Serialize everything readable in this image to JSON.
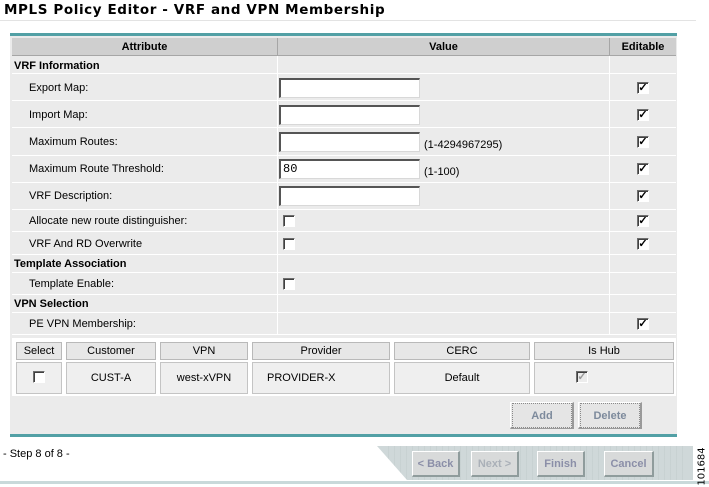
{
  "title": "MPLS Policy Editor - VRF and VPN Membership",
  "columns": {
    "attribute": "Attribute",
    "value": "Value",
    "editable": "Editable"
  },
  "sections": {
    "vrf_info": "VRF Information",
    "template_assoc": "Template Association",
    "vpn_selection": "VPN Selection"
  },
  "fields": {
    "export_map": {
      "label": "Export Map:",
      "value": "",
      "editable": true
    },
    "import_map": {
      "label": "Import Map:",
      "value": "",
      "editable": true
    },
    "max_routes": {
      "label": "Maximum Routes:",
      "value": "",
      "hint": "(1-4294967295)",
      "editable": true
    },
    "max_route_threshold": {
      "label": "Maximum Route Threshold:",
      "value": "80",
      "hint": "(1-100)",
      "editable": true
    },
    "vrf_description": {
      "label": "VRF Description:",
      "value": "",
      "editable": true
    },
    "allocate_rd": {
      "label": "Allocate new route distinguisher:",
      "checked": false,
      "editable": true
    },
    "vrf_rd_overwrite": {
      "label": "VRF And RD Overwrite",
      "checked": false,
      "editable": true
    },
    "template_enable": {
      "label": "Template Enable:",
      "checked": false
    },
    "pe_vpn_membership": {
      "label": "PE VPN Membership:",
      "editable": true
    }
  },
  "vpn_table": {
    "headers": [
      "Select",
      "Customer",
      "VPN",
      "Provider",
      "CERC",
      "Is Hub"
    ],
    "rows": [
      {
        "select": false,
        "customer": "CUST-A",
        "vpn": "west-xVPN",
        "provider": "PROVIDER-X",
        "cerc": "Default",
        "is_hub": true
      }
    ]
  },
  "buttons": {
    "add": "Add",
    "delete": "Delete"
  },
  "footer": {
    "step": "- Step 8 of 8 -",
    "back": "< Back",
    "next": "Next >",
    "finish": "Finish",
    "cancel": "Cancel"
  },
  "figure_id": "101684",
  "colors": {
    "accent_teal": "#52a0a5",
    "panel": "#ebebeb",
    "header": "#cfcfcf"
  }
}
